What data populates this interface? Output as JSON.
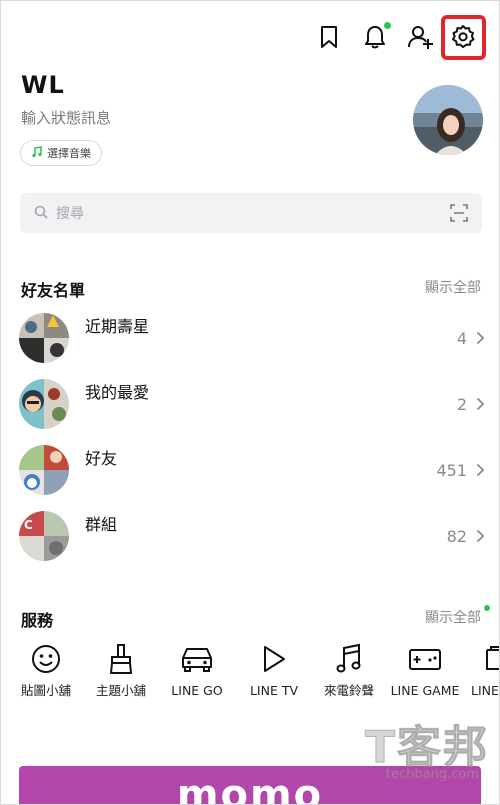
{
  "header": {
    "bookmark_icon": "bookmark-icon",
    "bell_icon": "bell-icon",
    "add_friend_icon": "add-friend-icon",
    "settings_icon": "gear-icon",
    "notification_dot_color": "#2bc25b",
    "highlight_color": "#e3262b"
  },
  "profile": {
    "name": "WL",
    "status_placeholder": "輸入狀態訊息",
    "music_label": "選擇音樂"
  },
  "search": {
    "placeholder": "搜尋"
  },
  "friends": {
    "title": "好友名單",
    "show_all": "顯示全部",
    "rows": [
      {
        "label": "近期壽星",
        "count": "4"
      },
      {
        "label": "我的最愛",
        "count": "2"
      },
      {
        "label": "好友",
        "count": "451"
      },
      {
        "label": "群組",
        "count": "82"
      }
    ]
  },
  "services": {
    "title": "服務",
    "show_all": "顯示全部",
    "items": [
      {
        "label": "貼圖小舖",
        "icon": "smiley-icon"
      },
      {
        "label": "主題小舖",
        "icon": "brush-icon"
      },
      {
        "label": "LINE GO",
        "icon": "car-icon"
      },
      {
        "label": "LINE TV",
        "icon": "play-icon"
      },
      {
        "label": "來電鈴聲",
        "icon": "music-note-icon"
      },
      {
        "label": "LINE GAME",
        "icon": "gamepad-icon"
      },
      {
        "label": "LINE",
        "icon": "service-icon"
      }
    ]
  },
  "banner": {
    "text": "momo",
    "color": "#b347a9"
  },
  "watermark": {
    "main": "T客邦",
    "sub": "techbang.com"
  }
}
